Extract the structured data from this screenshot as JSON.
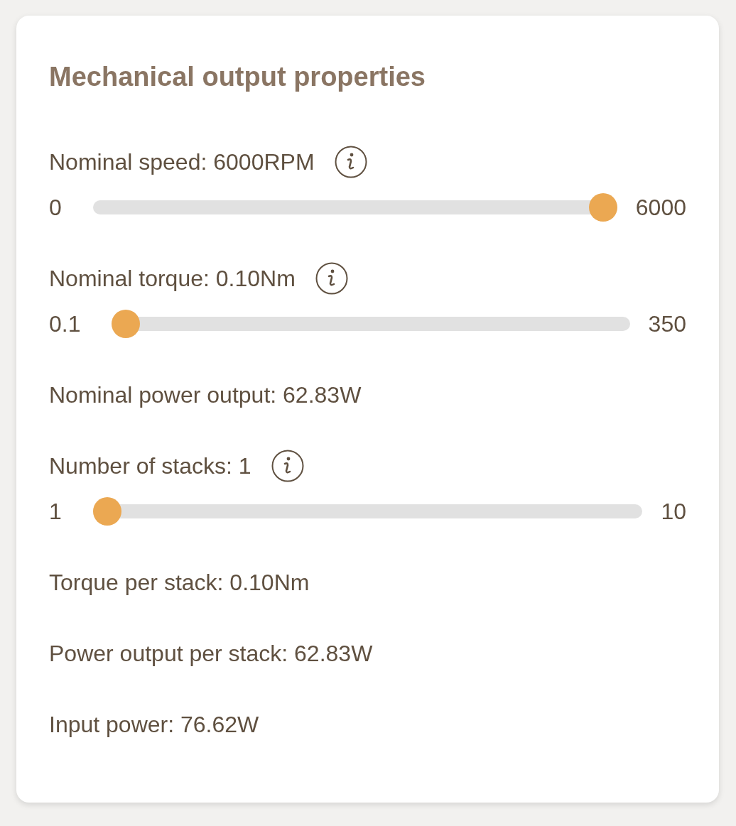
{
  "title": "Mechanical output properties",
  "items": [
    {
      "kind": "slider",
      "label": "Nominal speed: 6000RPM",
      "info": true,
      "min": "0",
      "max": "6000",
      "level": 1
    },
    {
      "kind": "slider",
      "label": "Nominal torque: 0.10Nm",
      "info": true,
      "min": "0.1",
      "max": "350",
      "level": 0
    },
    {
      "kind": "text",
      "label": "Nominal power output: 62.83W"
    },
    {
      "kind": "slider",
      "label": "Number of stacks: 1",
      "info": true,
      "min": "1",
      "max": "10",
      "level": 0
    },
    {
      "kind": "text",
      "label": "Torque per stack: 0.10Nm"
    },
    {
      "kind": "text",
      "label": "Power output per stack: 62.83W"
    },
    {
      "kind": "text",
      "label": "Input power: 76.62W"
    }
  ]
}
